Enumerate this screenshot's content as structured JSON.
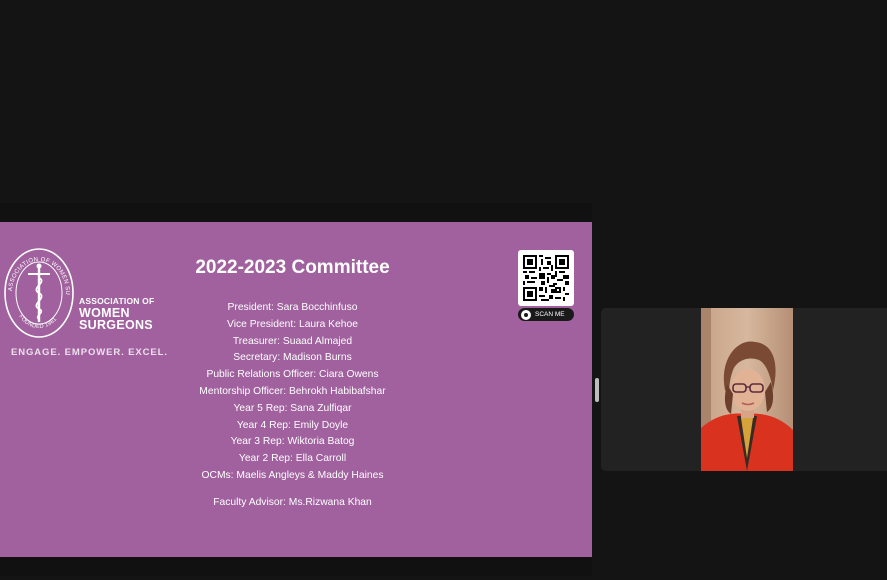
{
  "slide": {
    "logo": {
      "ring_text": "ASSOCIATION OF WOMEN SURGEONS",
      "founded_text": "FOUNDED 1981",
      "word_line1": "ASSOCIATION OF",
      "word_line2": "WOMEN",
      "word_line3": "SURGEONS",
      "tagline": "ENGAGE. EMPOWER. EXCEL."
    },
    "title": "2022-2023 Committee",
    "members": [
      "President: Sara Bocchinfuso",
      "Vice President: Laura Kehoe",
      "Treasurer: Suaad Almajed",
      "Secretary: Madison Burns",
      "Public Relations Officer: Ciara Owens",
      "Mentorship Officer: Behrokh Habibafshar",
      "Year 5 Rep: Sana Zulfiqar",
      "Year 4 Rep: Emily Doyle",
      "Year 3 Rep: Wiktoria Batog",
      "Year 2 Rep: Ella Carroll",
      "OCMs: Maelis Angleys & Maddy Haines"
    ],
    "faculty_advisor": "Faculty Advisor: Ms.Rizwana Khan",
    "qr": {
      "icon": "qr-code-icon",
      "scan_label": "SCAN ME"
    }
  },
  "video": {
    "participant": "video-feed"
  },
  "colors": {
    "background": "#141414",
    "slide": "#a0619e",
    "text": "#ffffff",
    "tile": "#222222",
    "jacket": "#d9331f"
  }
}
